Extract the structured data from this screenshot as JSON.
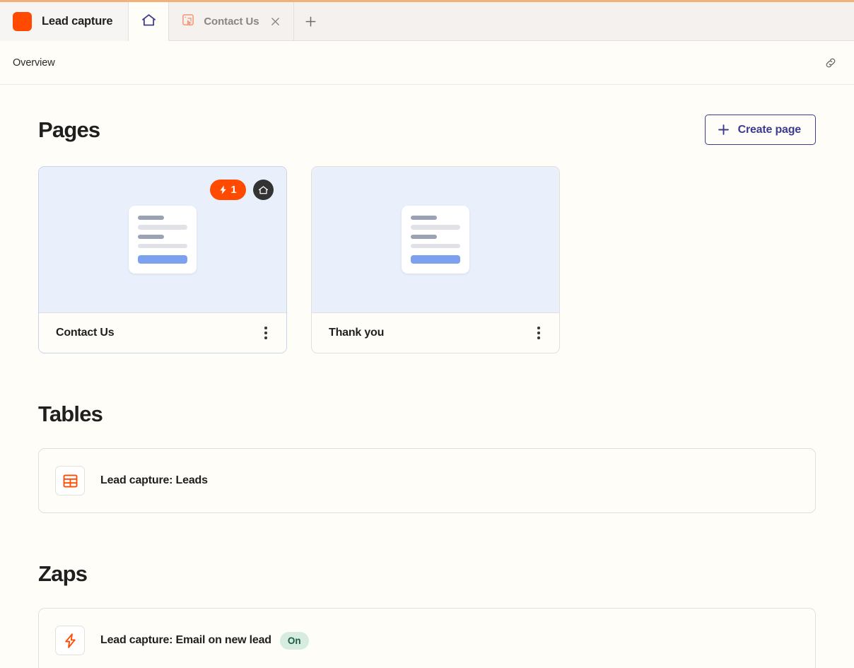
{
  "window": {
    "accent_color": "#f0b27a",
    "app_title": "Lead capture",
    "app_logo_color": "#ff4a00"
  },
  "tabs": {
    "home_tab": {
      "icon": "home-icon"
    },
    "open_tabs": [
      {
        "label": "Contact Us",
        "icon": "page-cursor-icon",
        "close_icon": "close-icon"
      }
    ],
    "new_tab_icon": "plus-icon"
  },
  "breadcrumb": {
    "label": "Overview",
    "link_icon": "link-icon"
  },
  "sections": {
    "pages": {
      "title": "Pages",
      "create_button": {
        "label": "Create page",
        "icon": "plus-icon",
        "color": "#3c3b8f"
      },
      "cards": [
        {
          "name": "Contact Us",
          "active": true,
          "badges": {
            "zap_count": "1",
            "zap_icon": "lightning-icon",
            "home_icon": "home-icon"
          },
          "menu_icon": "kebab-icon"
        },
        {
          "name": "Thank you",
          "active": false,
          "badges": null,
          "menu_icon": "kebab-icon"
        }
      ]
    },
    "tables": {
      "title": "Tables",
      "rows": [
        {
          "label": "Lead capture: Leads",
          "icon": "table-icon",
          "icon_color": "#ff4a00"
        }
      ]
    },
    "zaps": {
      "title": "Zaps",
      "rows": [
        {
          "label": "Lead capture: Email on new lead",
          "icon": "lightning-icon",
          "icon_color": "#ff4a00",
          "status": "On",
          "status_color": "#d6ece0"
        }
      ]
    }
  }
}
